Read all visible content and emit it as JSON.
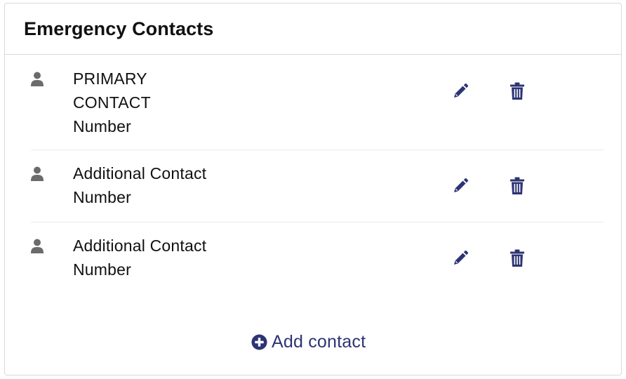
{
  "card": {
    "title": "Emergency Contacts"
  },
  "contacts": [
    {
      "name": "PRIMARY CONTACT",
      "number_label": "Number",
      "avatar_icon": "user-icon",
      "edit_icon": "pencil-icon",
      "delete_icon": "trash-icon"
    },
    {
      "name": "Additional Contact",
      "number_label": "Number",
      "avatar_icon": "user-icon",
      "edit_icon": "pencil-icon",
      "delete_icon": "trash-icon"
    },
    {
      "name": "Additional Contact",
      "number_label": "Number",
      "avatar_icon": "user-icon",
      "edit_icon": "pencil-icon",
      "delete_icon": "trash-icon"
    }
  ],
  "add_contact": {
    "label": "Add contact",
    "icon": "plus-circle-icon"
  },
  "colors": {
    "accent": "#2d3474",
    "avatar": "#6b6b6b",
    "border": "#d9d9d9",
    "divider": "#ececec"
  }
}
